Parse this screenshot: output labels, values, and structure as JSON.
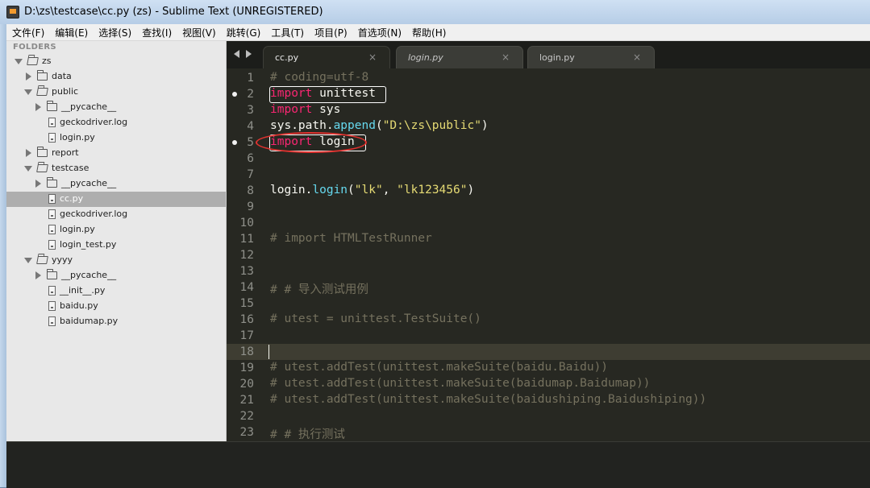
{
  "window": {
    "title": "D:\\zs\\testcase\\cc.py (zs) - Sublime Text (UNREGISTERED)"
  },
  "menu": [
    "文件(F)",
    "编辑(E)",
    "选择(S)",
    "查找(I)",
    "视图(V)",
    "跳转(G)",
    "工具(T)",
    "项目(P)",
    "首选项(N)",
    "帮助(H)"
  ],
  "sidebar": {
    "header": "FOLDERS",
    "items": [
      {
        "label": "zs",
        "type": "folder",
        "expanded": true,
        "depth": 0
      },
      {
        "label": "data",
        "type": "folder",
        "expanded": false,
        "depth": 1
      },
      {
        "label": "public",
        "type": "folder",
        "expanded": true,
        "depth": 1
      },
      {
        "label": "__pycache__",
        "type": "folder",
        "expanded": false,
        "depth": 2
      },
      {
        "label": "geckodriver.log",
        "type": "file",
        "depth": 2
      },
      {
        "label": "login.py",
        "type": "file",
        "depth": 2
      },
      {
        "label": "report",
        "type": "folder",
        "expanded": false,
        "depth": 1
      },
      {
        "label": "testcase",
        "type": "folder",
        "expanded": true,
        "depth": 1
      },
      {
        "label": "__pycache__",
        "type": "folder",
        "expanded": false,
        "depth": 2
      },
      {
        "label": "cc.py",
        "type": "file",
        "depth": 2,
        "selected": true
      },
      {
        "label": "geckodriver.log",
        "type": "file",
        "depth": 2
      },
      {
        "label": "login.py",
        "type": "file",
        "depth": 2
      },
      {
        "label": "login_test.py",
        "type": "file",
        "depth": 2
      },
      {
        "label": "yyyy",
        "type": "folder",
        "expanded": true,
        "depth": 1
      },
      {
        "label": "__pycache__",
        "type": "folder",
        "expanded": false,
        "depth": 2
      },
      {
        "label": "__init__.py",
        "type": "file",
        "depth": 2
      },
      {
        "label": "baidu.py",
        "type": "file",
        "depth": 2
      },
      {
        "label": "baidumap.py",
        "type": "file",
        "depth": 2
      }
    ]
  },
  "tabs": [
    {
      "label": "cc.py",
      "active": true,
      "italic": false,
      "close": "×"
    },
    {
      "label": "login.py",
      "active": false,
      "italic": true,
      "close": "×"
    },
    {
      "label": "login.py",
      "active": false,
      "italic": false,
      "close": "×"
    }
  ],
  "editor": {
    "current_line": 18,
    "modified_lines": [
      2,
      5
    ],
    "lines": [
      {
        "n": "1",
        "text": "# coding=utf-8"
      },
      {
        "n": "2",
        "text": "import unittest"
      },
      {
        "n": "3",
        "text": "import sys"
      },
      {
        "n": "4",
        "text": "sys.path.append(\"D:\\zs\\public\")"
      },
      {
        "n": "5",
        "text": "import login"
      },
      {
        "n": "6",
        "text": ""
      },
      {
        "n": "7",
        "text": ""
      },
      {
        "n": "8",
        "text": "login.login(\"lk\", \"lk123456\")"
      },
      {
        "n": "9",
        "text": ""
      },
      {
        "n": "10",
        "text": ""
      },
      {
        "n": "11",
        "text": "# import HTMLTestRunner"
      },
      {
        "n": "12",
        "text": ""
      },
      {
        "n": "13",
        "text": ""
      },
      {
        "n": "14",
        "text": "# # 导入测试用例"
      },
      {
        "n": "15",
        "text": ""
      },
      {
        "n": "16",
        "text": "# utest = unittest.TestSuite()"
      },
      {
        "n": "17",
        "text": ""
      },
      {
        "n": "18",
        "text": ""
      },
      {
        "n": "19",
        "text": "# utest.addTest(unittest.makeSuite(baidu.Baidu))"
      },
      {
        "n": "20",
        "text": "# utest.addTest(unittest.makeSuite(baidumap.Baidumap))"
      },
      {
        "n": "21",
        "text": "# utest.addTest(unittest.makeSuite(baidushiping.Baidushiping))"
      },
      {
        "n": "22",
        "text": ""
      },
      {
        "n": "23",
        "text": "# # 执行测试"
      }
    ]
  },
  "colors": {
    "comment": "#75715e",
    "keyword": "#f92672",
    "function": "#66d9ef",
    "string": "#e6db74",
    "plain": "#f8f8f2",
    "annotation": "#e0322f"
  }
}
